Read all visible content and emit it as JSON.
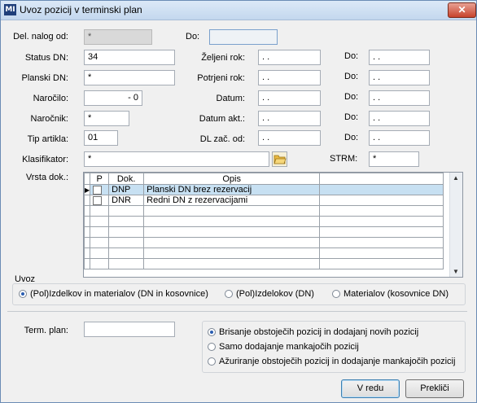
{
  "window": {
    "title": "Uvoz pozicij v terminski plan",
    "icon_text": "MI",
    "close": "✕"
  },
  "fields": {
    "del_nalog_label": "Del. nalog od:",
    "del_nalog_value": "*",
    "del_nalog_do_label": "Do:",
    "del_nalog_do_value": "",
    "status_label": "Status DN:",
    "status_value": "34",
    "planski_label": "Planski DN:",
    "planski_value": "*",
    "narocilo_label": "Naročilo:",
    "narocilo_value": "-  0",
    "narocnik_label": "Naročnik:",
    "narocnik_value": "*",
    "tip_label": "Tip artikla:",
    "tip_value": "01",
    "klasifikator_label": "Klasifikator:",
    "klasifikator_value": "*",
    "strm_label": "STRM:",
    "strm_value": "*",
    "zeljeni_label": "Željeni rok:",
    "zeljeni_value": ". .",
    "potrjeni_label": "Potrjeni rok:",
    "potrjeni_value": ". .",
    "datum_label": "Datum:",
    "datum_value": ". .",
    "datum_akt_label": "Datum akt.:",
    "datum_akt_value": ". .",
    "dl_label": "DL zač. od:",
    "dl_value": ". .",
    "do_label": "Do:",
    "do_value": ". .",
    "vrsta_label": "Vrsta dok.:"
  },
  "grid": {
    "headers": [
      "P",
      "Dok.",
      "Opis"
    ],
    "rows": [
      {
        "dok": "DNP",
        "opis": "Planski DN brez rezervacij"
      },
      {
        "dok": "DNR",
        "opis": "Redni DN z rezervacijami"
      }
    ]
  },
  "uvoz": {
    "label": "Uvoz",
    "options": [
      "(Pol)Izdelkov in materialov (DN in kosovnice)",
      "(Pol)Izdelokov (DN)",
      "Materialov (kosovnice DN)"
    ],
    "selected": 0
  },
  "term": {
    "label": "Term. plan:",
    "value": ""
  },
  "mode": {
    "options": [
      "Brisanje obstoječih pozicij in dodajanj novih pozicij",
      "Samo dodajanje mankajočih pozicij",
      "Ažuriranje obstoječih pozicij in dodajanje mankajočih pozicij"
    ],
    "selected": 0
  },
  "buttons": {
    "ok": "V redu",
    "cancel": "Prekliči"
  }
}
